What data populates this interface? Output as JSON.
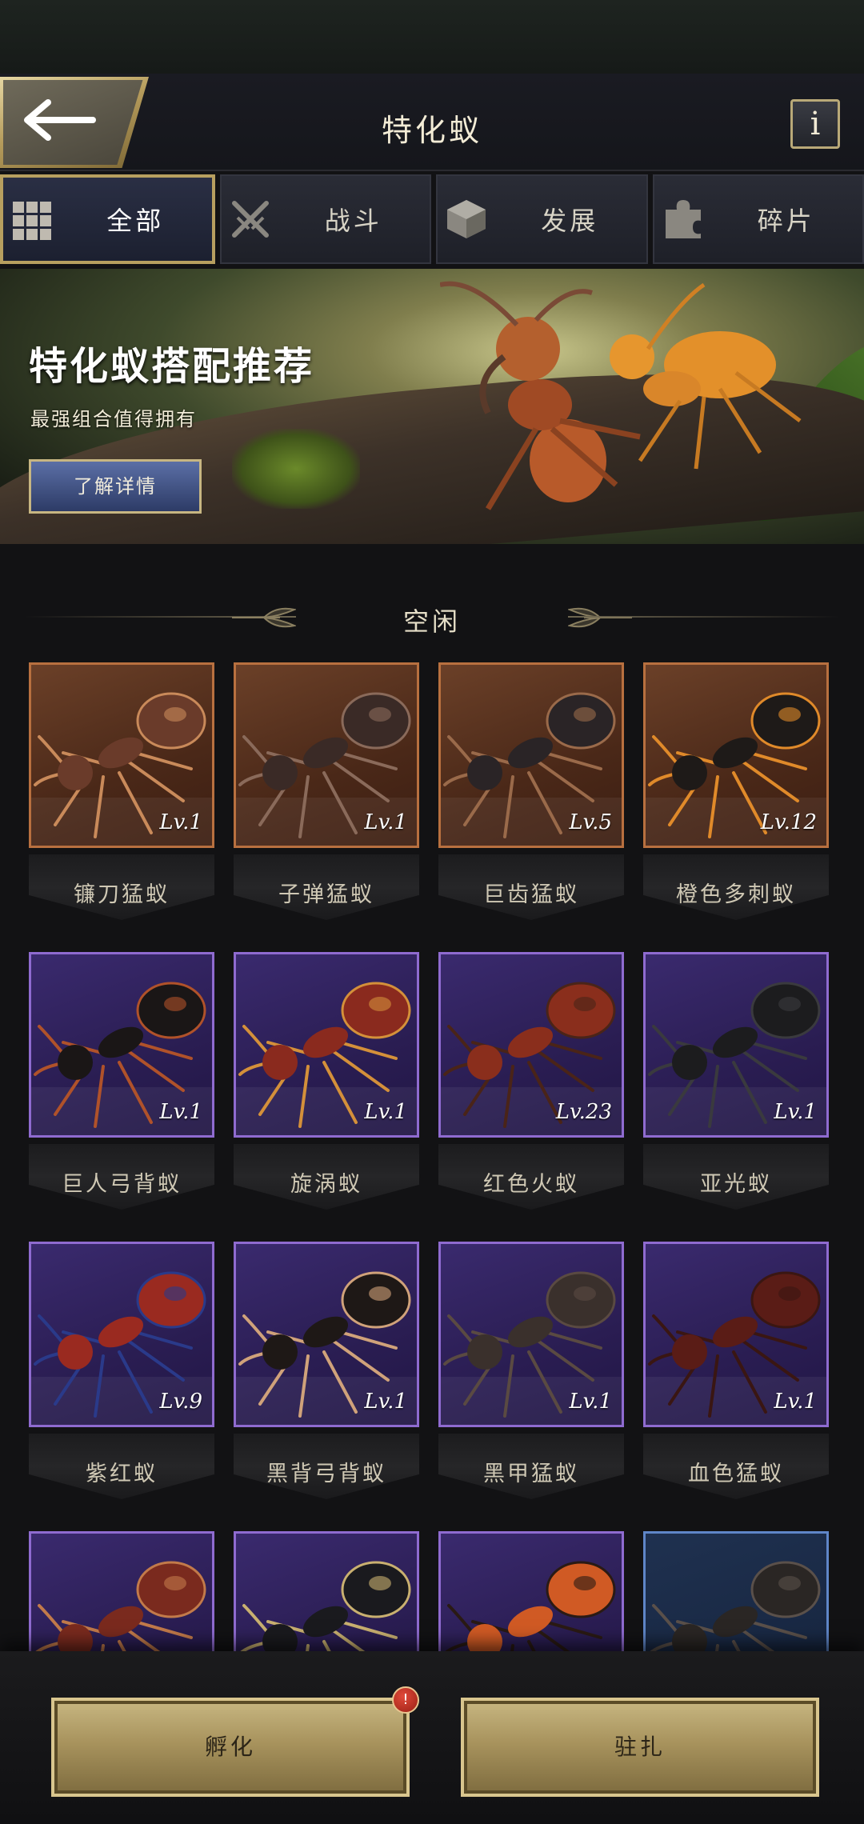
{
  "header": {
    "title": "特化蚁",
    "info_label": "i"
  },
  "tabs": [
    {
      "label": "全部",
      "icon": "grid-icon",
      "active": true
    },
    {
      "label": "战斗",
      "icon": "crossed-swords-icon",
      "active": false
    },
    {
      "label": "发展",
      "icon": "cube-icon",
      "active": false
    },
    {
      "label": "碎片",
      "icon": "puzzle-piece-icon",
      "active": false
    }
  ],
  "banner": {
    "title": "特化蚁搭配推荐",
    "subtitle": "最强组合值得拥有",
    "button_label": "了解详情"
  },
  "section": {
    "title": "空闲"
  },
  "ants": [
    {
      "name": "镰刀猛蚁",
      "level": "Lv.1",
      "rarity": "orange",
      "body_color": "#6a3b2a",
      "accent": "#c98a5a"
    },
    {
      "name": "子弹猛蚁",
      "level": "Lv.1",
      "rarity": "orange",
      "body_color": "#3a2a26",
      "accent": "#8a6a5a"
    },
    {
      "name": "巨齿猛蚁",
      "level": "Lv.5",
      "rarity": "orange",
      "body_color": "#2a2426",
      "accent": "#9a6a4a"
    },
    {
      "name": "橙色多刺蚁",
      "level": "Lv.12",
      "rarity": "orange",
      "body_color": "#1e1a18",
      "accent": "#e08a2a"
    },
    {
      "name": "巨人弓背蚁",
      "level": "Lv.1",
      "rarity": "purple",
      "body_color": "#1a1616",
      "accent": "#b0522a"
    },
    {
      "name": "旋涡蚁",
      "level": "Lv.1",
      "rarity": "purple",
      "body_color": "#8a2a1e",
      "accent": "#d4903a"
    },
    {
      "name": "红色火蚁",
      "level": "Lv.23",
      "rarity": "purple",
      "body_color": "#8a2e1c",
      "accent": "#4a2418"
    },
    {
      "name": "亚光蚁",
      "level": "Lv.1",
      "rarity": "purple",
      "body_color": "#1c1c1e",
      "accent": "#3a3a3e"
    },
    {
      "name": "紫红蚁",
      "level": "Lv.9",
      "rarity": "purple",
      "body_color": "#9a2a20",
      "accent": "#2a3a8a"
    },
    {
      "name": "黑背弓背蚁",
      "level": "Lv.1",
      "rarity": "purple",
      "body_color": "#1e1816",
      "accent": "#d0a27a"
    },
    {
      "name": "黑甲猛蚁",
      "level": "Lv.1",
      "rarity": "purple",
      "body_color": "#3a302c",
      "accent": "#5a4a42"
    },
    {
      "name": "血色猛蚁",
      "level": "Lv.1",
      "rarity": "purple",
      "body_color": "#5a1c16",
      "accent": "#3a1612"
    },
    {
      "name": "",
      "level": "",
      "rarity": "purple",
      "body_color": "#7a2a1e",
      "accent": "#c27a4a"
    },
    {
      "name": "",
      "level": "",
      "rarity": "purple",
      "body_color": "#1a1a1e",
      "accent": "#c9b070"
    },
    {
      "name": "",
      "level": "",
      "rarity": "purple",
      "body_color": "#d05a24",
      "accent": "#2a1a14"
    },
    {
      "name": "",
      "level": "",
      "rarity": "blue",
      "body_color": "#2a2624",
      "accent": "#5a504a"
    }
  ],
  "bottom": {
    "hatch_label": "孵化",
    "station_label": "驻扎",
    "badge": "!"
  }
}
